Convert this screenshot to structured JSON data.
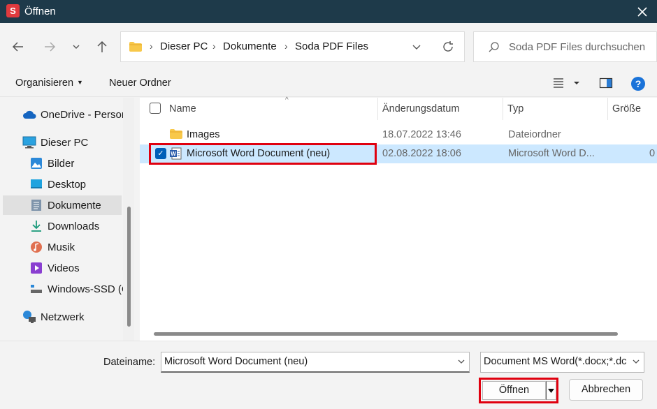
{
  "window": {
    "title": "Öffnen",
    "app_icon_letter": "S",
    "close_icon": "close-icon"
  },
  "navigation": {
    "back_icon": "arrow-left-icon",
    "forward_icon": "arrow-right-icon",
    "recent_icon": "chevron-down-icon",
    "up_icon": "arrow-up-icon"
  },
  "address": {
    "crumbs": [
      "Dieser PC",
      "Dokumente",
      "Soda PDF Files"
    ],
    "refresh_icon": "refresh-icon"
  },
  "search": {
    "placeholder": "Soda PDF Files durchsuchen"
  },
  "toolbar": {
    "organize_label": "Organisieren",
    "new_folder_label": "Neuer Ordner",
    "view_icon": "view-details-icon",
    "preview_icon": "preview-pane-icon",
    "help_icon": "help-icon"
  },
  "sidebar": {
    "items": [
      {
        "label": "OneDrive - Persor",
        "icon": "cloud-icon"
      },
      {
        "label": "Dieser PC",
        "icon": "computer-icon"
      },
      {
        "label": "Bilder",
        "icon": "pictures-icon"
      },
      {
        "label": "Desktop",
        "icon": "desktop-icon"
      },
      {
        "label": "Dokumente",
        "icon": "documents-icon",
        "selected": true
      },
      {
        "label": "Downloads",
        "icon": "download-icon"
      },
      {
        "label": "Musik",
        "icon": "music-icon"
      },
      {
        "label": "Videos",
        "icon": "videos-icon"
      },
      {
        "label": "Windows-SSD (C",
        "icon": "drive-icon"
      },
      {
        "label": "Netzwerk",
        "icon": "network-icon"
      }
    ]
  },
  "file_list": {
    "columns": [
      "Name",
      "Änderungsdatum",
      "Typ",
      "Größe"
    ],
    "rows": [
      {
        "name": "Images",
        "date": "18.07.2022 13:46",
        "type": "Dateiordner",
        "size": "",
        "icon": "folder-icon",
        "selected": false
      },
      {
        "name": "Microsoft Word Document (neu)",
        "date": "02.08.2022 18:06",
        "type": "Microsoft Word D...",
        "size": "0",
        "icon": "word-document-icon",
        "selected": true
      }
    ]
  },
  "footer": {
    "filename_label": "Dateiname:",
    "filename_value": "Microsoft Word Document (neu)",
    "filter_value": "Document MS Word(*.docx;*.dc",
    "open_label": "Öffnen",
    "cancel_label": "Abbrechen"
  },
  "colors": {
    "titlebar": "#1e3a4a",
    "selection": "#cce8ff",
    "highlight": "#e0000f",
    "accent": "#005fb8"
  }
}
